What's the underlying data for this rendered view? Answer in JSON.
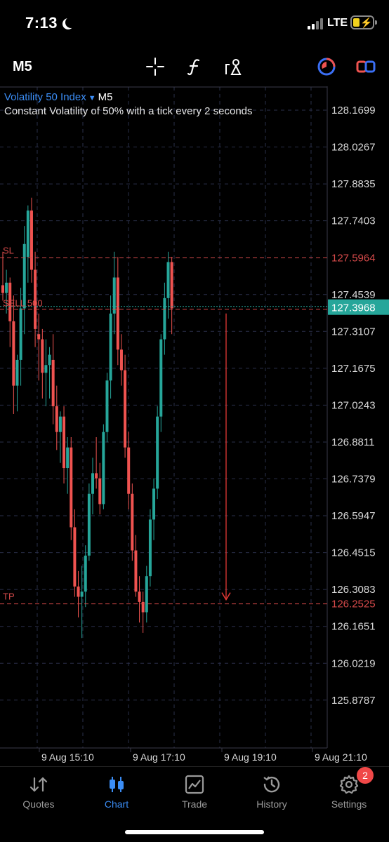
{
  "status": {
    "time": "7:13",
    "network": "LTE"
  },
  "toolbar": {
    "timeframe": "M5",
    "icons": [
      "crosshair-icon",
      "function-icon",
      "objects-icon",
      "trade-clock-icon",
      "toggle-icon"
    ]
  },
  "chart": {
    "symbol": "Volatility 50 Index",
    "timeframe": "M5",
    "description": "Constant Volatility of 50% with a tick every 2 seconds",
    "price_labels": [
      "128.1699",
      "128.0267",
      "127.8835",
      "127.7403",
      "127.4539",
      "127.3107",
      "127.1675",
      "127.0243",
      "126.8811",
      "126.7379",
      "126.5947",
      "126.4515",
      "126.3083",
      "126.1651",
      "126.0219",
      "125.8787"
    ],
    "sl_label": "SL",
    "sl_price": "127.5964",
    "sell_label": "SELL 500",
    "current_price": "127.3968",
    "tp_label": "TP",
    "tp_price": "126.2525",
    "time_labels": [
      "9 Aug 15:10",
      "9 Aug 17:10",
      "9 Aug 19:10",
      "9 Aug 21:10"
    ],
    "colors": {
      "bull": "#26a69a",
      "bear": "#ef5350",
      "sl_tp": "#d64a4a",
      "current": "#26a69a",
      "arrow": "#e53935",
      "grid": "#2a2f4a"
    }
  },
  "chart_data": {
    "type": "candlestick",
    "title": "Volatility 50 Index",
    "interval": "M5",
    "ylim": [
      125.8,
      128.22
    ],
    "x_ticks": [
      "9 Aug 15:10",
      "9 Aug 17:10",
      "9 Aug 19:10",
      "9 Aug 21:10"
    ],
    "candles": [
      {
        "o": 127.49,
        "h": 127.62,
        "l": 127.43,
        "c": 127.46
      },
      {
        "o": 127.46,
        "h": 127.55,
        "l": 127.38,
        "c": 127.5
      },
      {
        "o": 127.5,
        "h": 127.52,
        "l": 127.25,
        "c": 127.35
      },
      {
        "o": 127.35,
        "h": 127.45,
        "l": 126.99,
        "c": 127.1
      },
      {
        "o": 127.1,
        "h": 127.22,
        "l": 127.0,
        "c": 127.2
      },
      {
        "o": 127.2,
        "h": 127.48,
        "l": 127.1,
        "c": 127.4
      },
      {
        "o": 127.4,
        "h": 127.72,
        "l": 127.3,
        "c": 127.65
      },
      {
        "o": 127.6,
        "h": 127.8,
        "l": 127.5,
        "c": 127.78
      },
      {
        "o": 127.78,
        "h": 127.83,
        "l": 127.5,
        "c": 127.55
      },
      {
        "o": 127.55,
        "h": 127.62,
        "l": 127.25,
        "c": 127.32
      },
      {
        "o": 127.3,
        "h": 127.38,
        "l": 127.12,
        "c": 127.28
      },
      {
        "o": 127.28,
        "h": 127.32,
        "l": 127.05,
        "c": 127.15
      },
      {
        "o": 127.15,
        "h": 127.28,
        "l": 127.02,
        "c": 127.18
      },
      {
        "o": 127.18,
        "h": 127.25,
        "l": 127.05,
        "c": 127.22
      },
      {
        "o": 127.2,
        "h": 127.3,
        "l": 126.95,
        "c": 127.02
      },
      {
        "o": 127.02,
        "h": 127.1,
        "l": 126.85,
        "c": 126.92
      },
      {
        "o": 126.92,
        "h": 127.0,
        "l": 126.8,
        "c": 126.98
      },
      {
        "o": 126.98,
        "h": 127.02,
        "l": 126.72,
        "c": 126.78
      },
      {
        "o": 126.78,
        "h": 126.9,
        "l": 126.68,
        "c": 126.86
      },
      {
        "o": 126.86,
        "h": 126.9,
        "l": 126.5,
        "c": 126.55
      },
      {
        "o": 126.55,
        "h": 126.62,
        "l": 126.28,
        "c": 126.32
      },
      {
        "o": 126.32,
        "h": 126.38,
        "l": 126.2,
        "c": 126.28
      },
      {
        "o": 126.28,
        "h": 126.4,
        "l": 126.12,
        "c": 126.3
      },
      {
        "o": 126.3,
        "h": 126.48,
        "l": 126.24,
        "c": 126.44
      },
      {
        "o": 126.44,
        "h": 126.72,
        "l": 126.42,
        "c": 126.68
      },
      {
        "o": 126.68,
        "h": 126.82,
        "l": 126.6,
        "c": 126.76
      },
      {
        "o": 126.76,
        "h": 126.9,
        "l": 126.7,
        "c": 126.74
      },
      {
        "o": 126.74,
        "h": 126.8,
        "l": 126.6,
        "c": 126.64
      },
      {
        "o": 126.64,
        "h": 126.95,
        "l": 126.62,
        "c": 126.92
      },
      {
        "o": 126.92,
        "h": 127.15,
        "l": 126.88,
        "c": 127.12
      },
      {
        "o": 127.12,
        "h": 127.45,
        "l": 127.05,
        "c": 127.38
      },
      {
        "o": 127.38,
        "h": 127.62,
        "l": 127.3,
        "c": 127.52
      },
      {
        "o": 127.52,
        "h": 127.6,
        "l": 127.18,
        "c": 127.24
      },
      {
        "o": 127.24,
        "h": 127.3,
        "l": 127.1,
        "c": 127.16
      },
      {
        "o": 127.16,
        "h": 127.22,
        "l": 126.82,
        "c": 126.86
      },
      {
        "o": 126.86,
        "h": 126.92,
        "l": 126.62,
        "c": 126.68
      },
      {
        "o": 126.68,
        "h": 126.72,
        "l": 126.42,
        "c": 126.46
      },
      {
        "o": 126.46,
        "h": 126.52,
        "l": 126.28,
        "c": 126.3
      },
      {
        "o": 126.3,
        "h": 126.36,
        "l": 126.18,
        "c": 126.26
      },
      {
        "o": 126.26,
        "h": 126.3,
        "l": 126.14,
        "c": 126.22
      },
      {
        "o": 126.22,
        "h": 126.4,
        "l": 126.18,
        "c": 126.36
      },
      {
        "o": 126.36,
        "h": 126.62,
        "l": 126.32,
        "c": 126.58
      },
      {
        "o": 126.58,
        "h": 126.74,
        "l": 126.5,
        "c": 126.7
      },
      {
        "o": 126.7,
        "h": 127.02,
        "l": 126.66,
        "c": 126.98
      },
      {
        "o": 126.98,
        "h": 127.3,
        "l": 126.92,
        "c": 127.28
      },
      {
        "o": 127.28,
        "h": 127.5,
        "l": 127.22,
        "c": 127.44
      },
      {
        "o": 127.44,
        "h": 127.62,
        "l": 127.36,
        "c": 127.58
      },
      {
        "o": 127.58,
        "h": 127.6,
        "l": 127.3,
        "c": 127.4
      }
    ],
    "levels": {
      "sl": 127.5964,
      "entry_sell": 127.3968,
      "tp": 126.2525
    }
  },
  "tabs": [
    {
      "label": "Quotes",
      "icon": "quotes-icon"
    },
    {
      "label": "Chart",
      "icon": "chart-icon",
      "active": true
    },
    {
      "label": "Trade",
      "icon": "trade-icon"
    },
    {
      "label": "History",
      "icon": "history-icon"
    },
    {
      "label": "Settings",
      "icon": "settings-icon"
    }
  ],
  "settings_badge": "2"
}
